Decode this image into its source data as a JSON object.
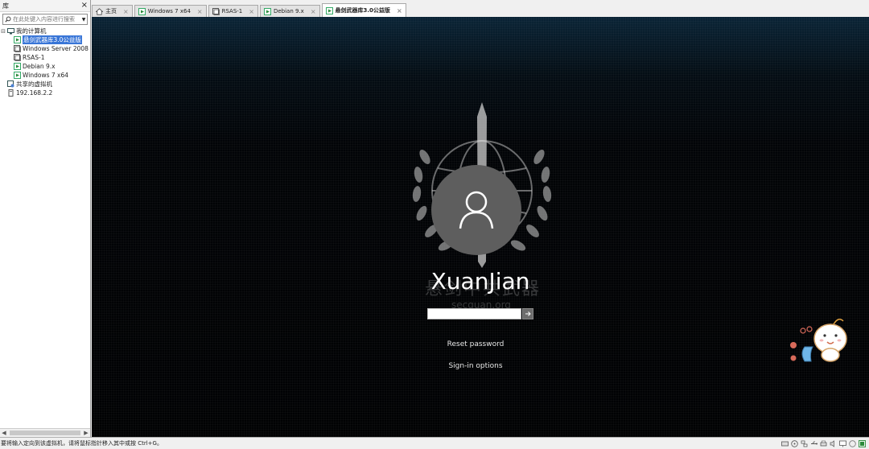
{
  "library": {
    "title": "库",
    "search_placeholder": "在此处键入内容进行搜索",
    "tree": {
      "my_computer": "我的计算机",
      "vms": [
        "悬剑武器库3.0公益版",
        "Windows Server 2008",
        "RSAS-1",
        "Debian 9.x",
        "Windows 7 x64"
      ],
      "selected_index": 0,
      "shared_vms": "共享的虚拟机",
      "remote_host": "192.168.2.2"
    }
  },
  "tabs": [
    {
      "label": "主页",
      "icon": "home-icon"
    },
    {
      "label": "Windows 7 x64",
      "icon": "vm-icon"
    },
    {
      "label": "RSAS-1",
      "icon": "vm-icon"
    },
    {
      "label": "Debian 9.x",
      "icon": "vm-icon"
    },
    {
      "label": "悬剑武器库3.0公益版",
      "icon": "vm-icon",
      "active": true
    }
  ],
  "login": {
    "username": "XuanJian",
    "watermark_text": "悬剑中共武器",
    "watermark_url": "secquan.org",
    "password_value": "",
    "reset_password": "Reset password",
    "sign_in_options": "Sign-in options"
  },
  "status_bar": {
    "message": "要将输入定向到该虚拟机，请将鼠标指针移入其中或按 Ctrl+G。",
    "icons": [
      "hdd-icon",
      "cd-icon",
      "network-icon",
      "usb-icon",
      "printer-icon",
      "sound-icon",
      "display-icon",
      "message-icon",
      "fullscreen-icon"
    ]
  },
  "colors": {
    "selection": "#3875d7",
    "avatar_bg": "#5e5e5e",
    "screen_bg": "#020407"
  }
}
